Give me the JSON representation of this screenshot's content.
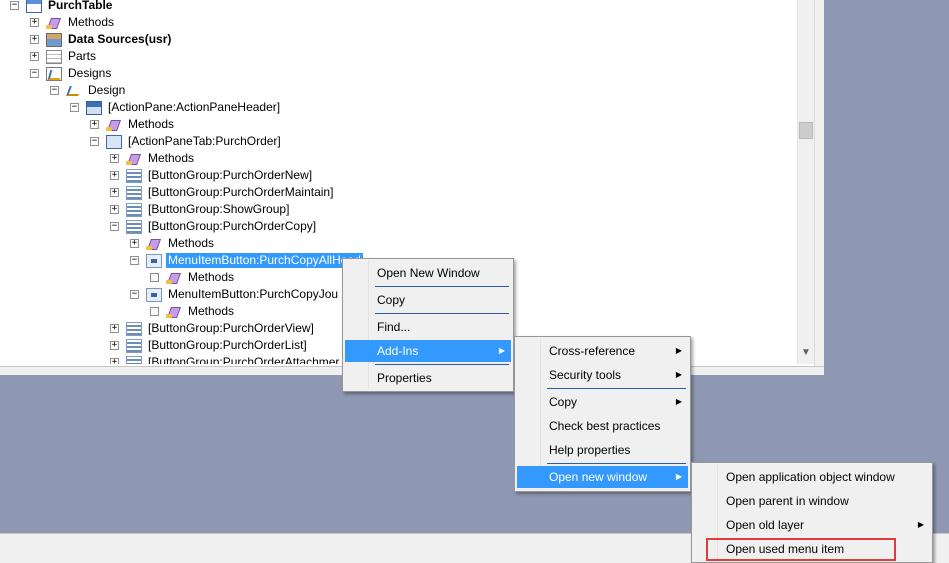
{
  "tree": {
    "rows": [
      {
        "id": "purchtable",
        "label": "PurchTable",
        "bold": true,
        "expander": "−",
        "icon": "table-icon"
      },
      {
        "id": "methods-root",
        "label": "Methods",
        "expander": "+",
        "icon": "methods-icon"
      },
      {
        "id": "datasources",
        "label": "Data Sources(usr)",
        "bold": true,
        "expander": "+",
        "icon": "datasources-icon"
      },
      {
        "id": "parts",
        "label": "Parts",
        "expander": "+",
        "icon": "parts-icon"
      },
      {
        "id": "designs",
        "label": "Designs",
        "expander": "−",
        "icon": "designs-icon"
      },
      {
        "id": "design",
        "label": "Design",
        "expander": "−",
        "icon": "design-icon"
      },
      {
        "id": "actionpane",
        "label": "[ActionPane:ActionPaneHeader]",
        "expander": "−",
        "icon": "actionpane-icon"
      },
      {
        "id": "methods-ap",
        "label": "Methods",
        "expander": "+",
        "icon": "methods-icon"
      },
      {
        "id": "actionpanetab",
        "label": "[ActionPaneTab:PurchOrder]",
        "expander": "−",
        "icon": "actionpanetab-icon"
      },
      {
        "id": "methods-apt",
        "label": "Methods",
        "expander": "+",
        "icon": "methods-icon"
      },
      {
        "id": "bg-new",
        "label": "[ButtonGroup:PurchOrderNew]",
        "expander": "+",
        "icon": "buttongroup-icon"
      },
      {
        "id": "bg-maintain",
        "label": "[ButtonGroup:PurchOrderMaintain]",
        "expander": "+",
        "icon": "buttongroup-icon"
      },
      {
        "id": "bg-show",
        "label": "[ButtonGroup:ShowGroup]",
        "expander": "+",
        "icon": "buttongroup-icon"
      },
      {
        "id": "bg-copy",
        "label": "[ButtonGroup:PurchOrderCopy]",
        "expander": "−",
        "icon": "buttongroup-icon"
      },
      {
        "id": "methods-bgc",
        "label": "Methods",
        "expander": "+",
        "icon": "methods-icon"
      },
      {
        "id": "mib-allheader",
        "label": "MenuItemButton:PurchCopyAllHead",
        "expander": "−",
        "icon": "menubutton-icon",
        "selected": true
      },
      {
        "id": "methods-mib1",
        "label": "Methods",
        "expander": "",
        "icon": "methods-icon"
      },
      {
        "id": "mib-journal",
        "label": "MenuItemButton:PurchCopyJou",
        "expander": "−",
        "icon": "menubutton-icon"
      },
      {
        "id": "methods-mib2",
        "label": "Methods",
        "expander": "",
        "icon": "methods-icon"
      },
      {
        "id": "bg-view",
        "label": "[ButtonGroup:PurchOrderView]",
        "expander": "+",
        "icon": "buttongroup-icon"
      },
      {
        "id": "bg-list",
        "label": "[ButtonGroup:PurchOrderList]",
        "expander": "+",
        "icon": "buttongroup-icon"
      },
      {
        "id": "bg-attach",
        "label": "[ButtonGroup:PurchOrderAttachmer",
        "expander": "+",
        "icon": "buttongroup-icon"
      }
    ]
  },
  "menu1": {
    "items": [
      {
        "label": "Open New Window"
      },
      {
        "label": "Copy"
      },
      {
        "label": "Find..."
      },
      {
        "label": "Add-Ins",
        "submenu": true,
        "highlight": true
      },
      {
        "label": "Properties"
      }
    ]
  },
  "menu2": {
    "items": [
      {
        "label": "Cross-reference",
        "submenu": true
      },
      {
        "label": "Security tools",
        "submenu": true
      },
      {
        "label": "Copy",
        "submenu": true
      },
      {
        "label": "Check best practices"
      },
      {
        "label": "Help properties"
      },
      {
        "label": "Open new window",
        "submenu": true,
        "highlight": true
      }
    ]
  },
  "menu3": {
    "items": [
      {
        "label": "Open application object window"
      },
      {
        "label": "Open parent in window"
      },
      {
        "label": "Open old layer",
        "submenu": true
      },
      {
        "label": "Open used menu item",
        "outlined": true
      }
    ]
  },
  "colors": {
    "highlight": "#3399ff",
    "background": "#8f98b3",
    "annotation": "#e03c3c"
  }
}
